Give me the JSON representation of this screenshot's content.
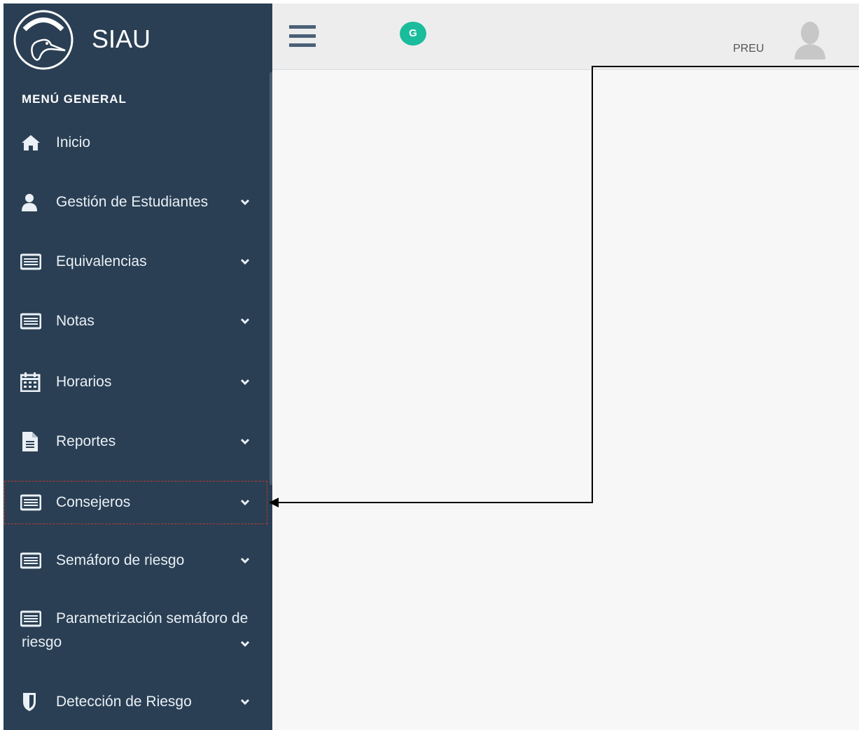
{
  "brand": {
    "name": "SIAU"
  },
  "sidebar": {
    "section_title": "MENÚ GENERAL",
    "items": [
      {
        "label": "Inicio",
        "icon": "home-icon"
      },
      {
        "label": "Gestión de Estudiantes",
        "icon": "user-icon"
      },
      {
        "label": "Equivalencias",
        "icon": "table-icon"
      },
      {
        "label": "Notas",
        "icon": "table-icon"
      },
      {
        "label": "Horarios",
        "icon": "calendar-icon"
      },
      {
        "label": "Reportes",
        "icon": "file-icon"
      },
      {
        "label": "Consejeros",
        "icon": "table-icon"
      },
      {
        "label": "Semáforo de riesgo",
        "icon": "table-icon"
      },
      {
        "label": "Parametrización semáforo de",
        "label2": "riesgo",
        "icon": "table-icon"
      },
      {
        "label": "Detección de Riesgo",
        "icon": "shield-icon"
      }
    ]
  },
  "topbar": {
    "badge": "G",
    "user": "PREU"
  },
  "colors": {
    "sidebar": "#2a3f54",
    "accent": "#1abc9c"
  }
}
